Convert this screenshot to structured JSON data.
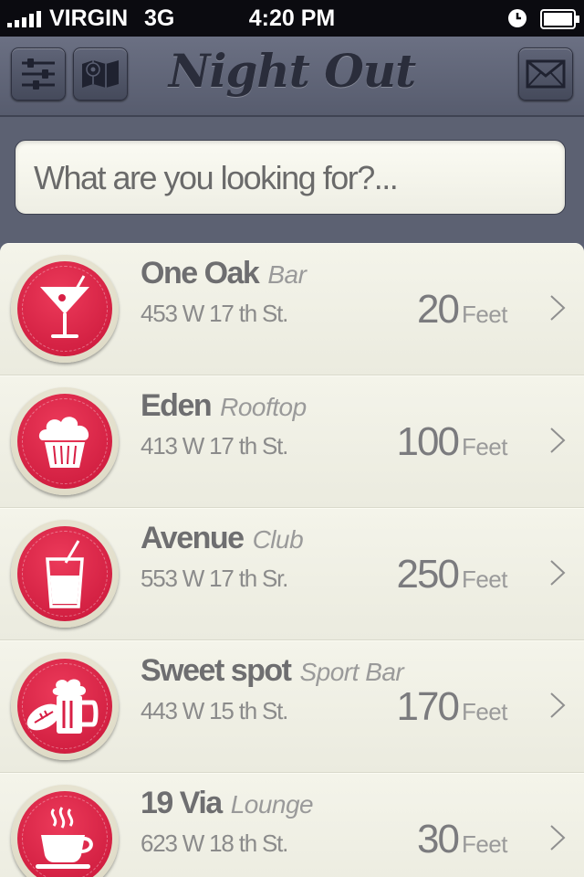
{
  "status_bar": {
    "carrier": "VIRGIN",
    "network": "3G",
    "time": "4:20 PM",
    "icons": [
      "signal-icon",
      "clock-icon",
      "battery-icon"
    ]
  },
  "nav": {
    "title": "Night Out",
    "left_buttons": [
      "filter-sliders-icon",
      "map-pin-icon"
    ],
    "right_button": "mail-icon"
  },
  "search": {
    "placeholder": "What are you looking for?..."
  },
  "colors": {
    "accent_red": "#d81f45",
    "nav_bg": "#60657a",
    "list_bg": "#eeeee2"
  },
  "places": [
    {
      "name": "One Oak",
      "category": "Bar",
      "address": "453 W 17 th St.",
      "distance": "20",
      "unit": "Feet",
      "icon": "cocktail-icon"
    },
    {
      "name": "Eden",
      "category": "Rooftop",
      "address": "413 W 17 th St.",
      "distance": "100",
      "unit": "Feet",
      "icon": "cupcake-icon"
    },
    {
      "name": "Avenue",
      "category": "Club",
      "address": "553 W 17 th Sr.",
      "distance": "250",
      "unit": "Feet",
      "icon": "drink-straw-icon"
    },
    {
      "name": "Sweet spot",
      "category": "Sport Bar",
      "address": "443 W 15 th St.",
      "distance": "170",
      "unit": "Feet",
      "icon": "football-beer-icon"
    },
    {
      "name": "19 Via",
      "category": "Lounge",
      "address": "623 W 18 th St.",
      "distance": "30",
      "unit": "Feet",
      "icon": "coffee-cup-icon"
    }
  ]
}
